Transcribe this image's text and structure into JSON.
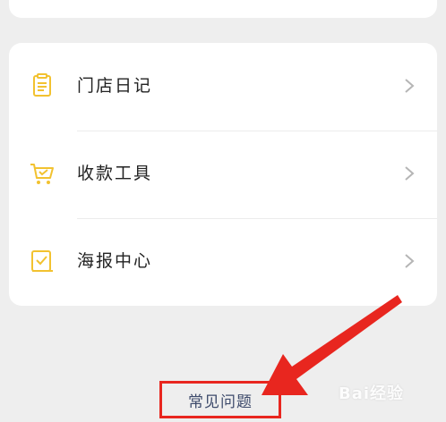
{
  "menu": {
    "items": [
      {
        "label": "门店日记",
        "icon": "diary-icon"
      },
      {
        "label": "收款工具",
        "icon": "cart-icon"
      },
      {
        "label": "海报中心",
        "icon": "poster-icon"
      }
    ]
  },
  "faq": {
    "label": "常见问题"
  },
  "watermark": {
    "text": "Bai经验"
  },
  "colors": {
    "accent": "#f2c230",
    "highlight": "#e8261f",
    "link": "#3d4a6b"
  }
}
